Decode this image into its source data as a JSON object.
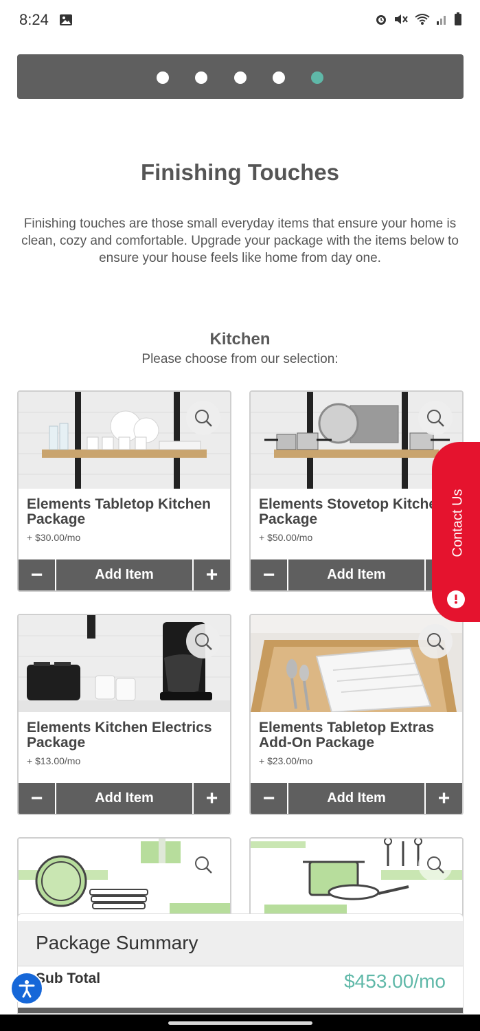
{
  "status_bar": {
    "time": "8:24",
    "icons": [
      "image-icon",
      "alarm-icon",
      "mute-icon",
      "wifi-icon",
      "signal-icon",
      "battery-icon"
    ]
  },
  "progress": {
    "steps": 5,
    "current_step": 5,
    "active_color": "#5fb8a8"
  },
  "page": {
    "title": "Finishing Touches",
    "intro": "Finishing touches are those small everyday items that ensure your home is clean, cozy and comfortable. Upgrade your package with the items below to ensure your house feels like home from day one."
  },
  "section": {
    "title": "Kitchen",
    "subtitle": "Please choose from our selection:"
  },
  "products": [
    {
      "name": "Elements Tabletop Kitchen Package",
      "price": "+ $30.00/mo",
      "add_label": "Add Item",
      "minus": "−",
      "plus": "+"
    },
    {
      "name": "Elements Stovetop Kitchen Package",
      "price": "+ $50.00/mo",
      "add_label": "Add Item",
      "minus": "−",
      "plus": "+"
    },
    {
      "name": "Elements Kitchen Electrics Package",
      "price": "+ $13.00/mo",
      "add_label": "Add Item",
      "minus": "−",
      "plus": "+"
    },
    {
      "name": "Elements Tabletop Extras Add-On Package",
      "price": "+ $23.00/mo",
      "add_label": "Add Item",
      "minus": "−",
      "plus": "+"
    }
  ],
  "contact_tab": {
    "label": "Contact Us",
    "color": "#e5132e"
  },
  "summary": {
    "title": "Package Summary",
    "subtotal_label": "Sub Total",
    "subtotal_value": "$453.00/mo",
    "value_color": "#5fb8a8"
  },
  "colors": {
    "bar_gray": "#5f5f5f",
    "accessibility_blue": "#1667d8"
  }
}
